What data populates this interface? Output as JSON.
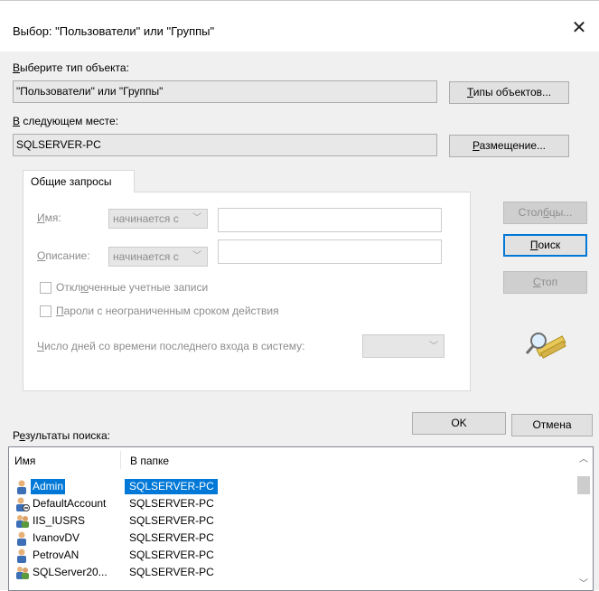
{
  "window": {
    "title": "Выбор: \"Пользователи\" или \"Группы\"",
    "close_glyph": "✕"
  },
  "object_type": {
    "label_u": "В",
    "label_rest": "ыберите тип объекта:",
    "value": "\"Пользователи\" или \"Группы\"",
    "button_u": "Т",
    "button_rest": "ипы объектов..."
  },
  "location": {
    "label_u": "В",
    "label_rest": " следующем месте:",
    "value": "SQLSERVER-PC",
    "button_u": "Р",
    "button_rest": "азмещение..."
  },
  "query_tab": {
    "label": "Общие запросы",
    "name_label_u": "И",
    "name_label_rest": "мя:",
    "name_op": "начинается с",
    "desc_label_u": "О",
    "desc_label_rest": "писание:",
    "desc_op": "начинается с",
    "disabled_accounts_pre": "Откл",
    "disabled_accounts_u": "ю",
    "disabled_accounts_post": "ченные учетные записи",
    "no_expire_u": "П",
    "no_expire_rest": "ароли с неограниченным сроком действия",
    "days_u": "Ч",
    "days_rest": "исло дней со времени последнего входа в систему:"
  },
  "buttons": {
    "columns_pre": "Стол",
    "columns_u": "б",
    "columns_post": "цы...",
    "search_u": "П",
    "search_rest": "оиск",
    "stop_u": "С",
    "stop_rest": "топ",
    "ok": "OK",
    "cancel": "Отмена"
  },
  "results": {
    "label_pre": "Р",
    "label_u": "е",
    "label_post": "зультаты поиска:",
    "columns": [
      "Имя",
      "В папке"
    ],
    "rows": [
      {
        "name": "Admin",
        "folder": "SQLSERVER-PC",
        "icon": "user-icon",
        "selected": true
      },
      {
        "name": "DefaultAccount",
        "folder": "SQLSERVER-PC",
        "icon": "user-disabled-icon",
        "selected": false
      },
      {
        "name": "IIS_IUSRS",
        "folder": "SQLSERVER-PC",
        "icon": "group-icon",
        "selected": false
      },
      {
        "name": "IvanovDV",
        "folder": "SQLSERVER-PC",
        "icon": "user-icon",
        "selected": false
      },
      {
        "name": "PetrovAN",
        "folder": "SQLSERVER-PC",
        "icon": "user-icon",
        "selected": false
      },
      {
        "name": "SQLServer20...",
        "folder": "SQLSERVER-PC",
        "icon": "group-icon",
        "selected": false
      }
    ]
  },
  "icons": {
    "search_graphic": "magnifier-icon"
  },
  "colors": {
    "accent": "#0078d7",
    "dialog_bg": "#f0f0f0"
  }
}
